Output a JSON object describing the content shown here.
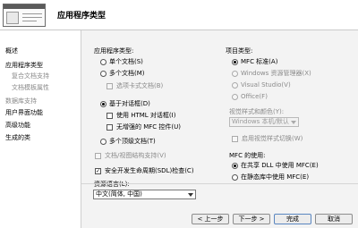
{
  "header": {
    "title": "应用程序类型"
  },
  "sidebar": {
    "items": [
      {
        "label": "概述"
      },
      {
        "label": "应用程序类型"
      },
      {
        "label": "复合文档支持"
      },
      {
        "label": "文档模板属性"
      },
      {
        "label": "数据库支持"
      },
      {
        "label": "用户界面功能"
      },
      {
        "label": "高级功能"
      },
      {
        "label": "生成的类"
      }
    ]
  },
  "app_type": {
    "group_label": "应用程序类型:",
    "single_doc": "单个文档(S)",
    "multi_doc": "多个文档(M)",
    "tabbed_docs": "选项卡式文档(B)",
    "dialog_based": "基于对话框(D)",
    "use_html_dialog": "使用 HTML 对话框(I)",
    "no_enhanced_mfc": "无增强的 MFC 控件(U)",
    "multi_top_level": "多个顶级文档(T)",
    "doc_view_support": "文档/视图结构支持(V)",
    "sdl_checks": "安全开发生命周期(SDL)检查(C)",
    "resource_lang_label": "资源语言(L):",
    "resource_lang_value": "中文(简体, 中国)",
    "selected": "dialog_based"
  },
  "project_type": {
    "group_label": "项目类型:",
    "mfc_standard": "MFC 标准(A)",
    "windows_explorer": "Windows 资源管理器(X)",
    "visual_studio": "Visual Studio(V)",
    "office": "Office(F)",
    "style_color_label": "视觉样式和颜色(Y):",
    "style_color_value": "Windows 本机/默认",
    "enable_style_switch": "启用视觉样式切换(W)",
    "selected": "mfc_standard"
  },
  "mfc_use": {
    "group_label": "MFC 的使用:",
    "shared_dll": "在共享 DLL 中使用 MFC(E)",
    "static_lib": "在静态库中使用 MFC(E)",
    "selected": "shared_dll"
  },
  "footer": {
    "prev": "< 上一步",
    "next": "下一步 >",
    "finish": "完成",
    "cancel": "取消"
  }
}
